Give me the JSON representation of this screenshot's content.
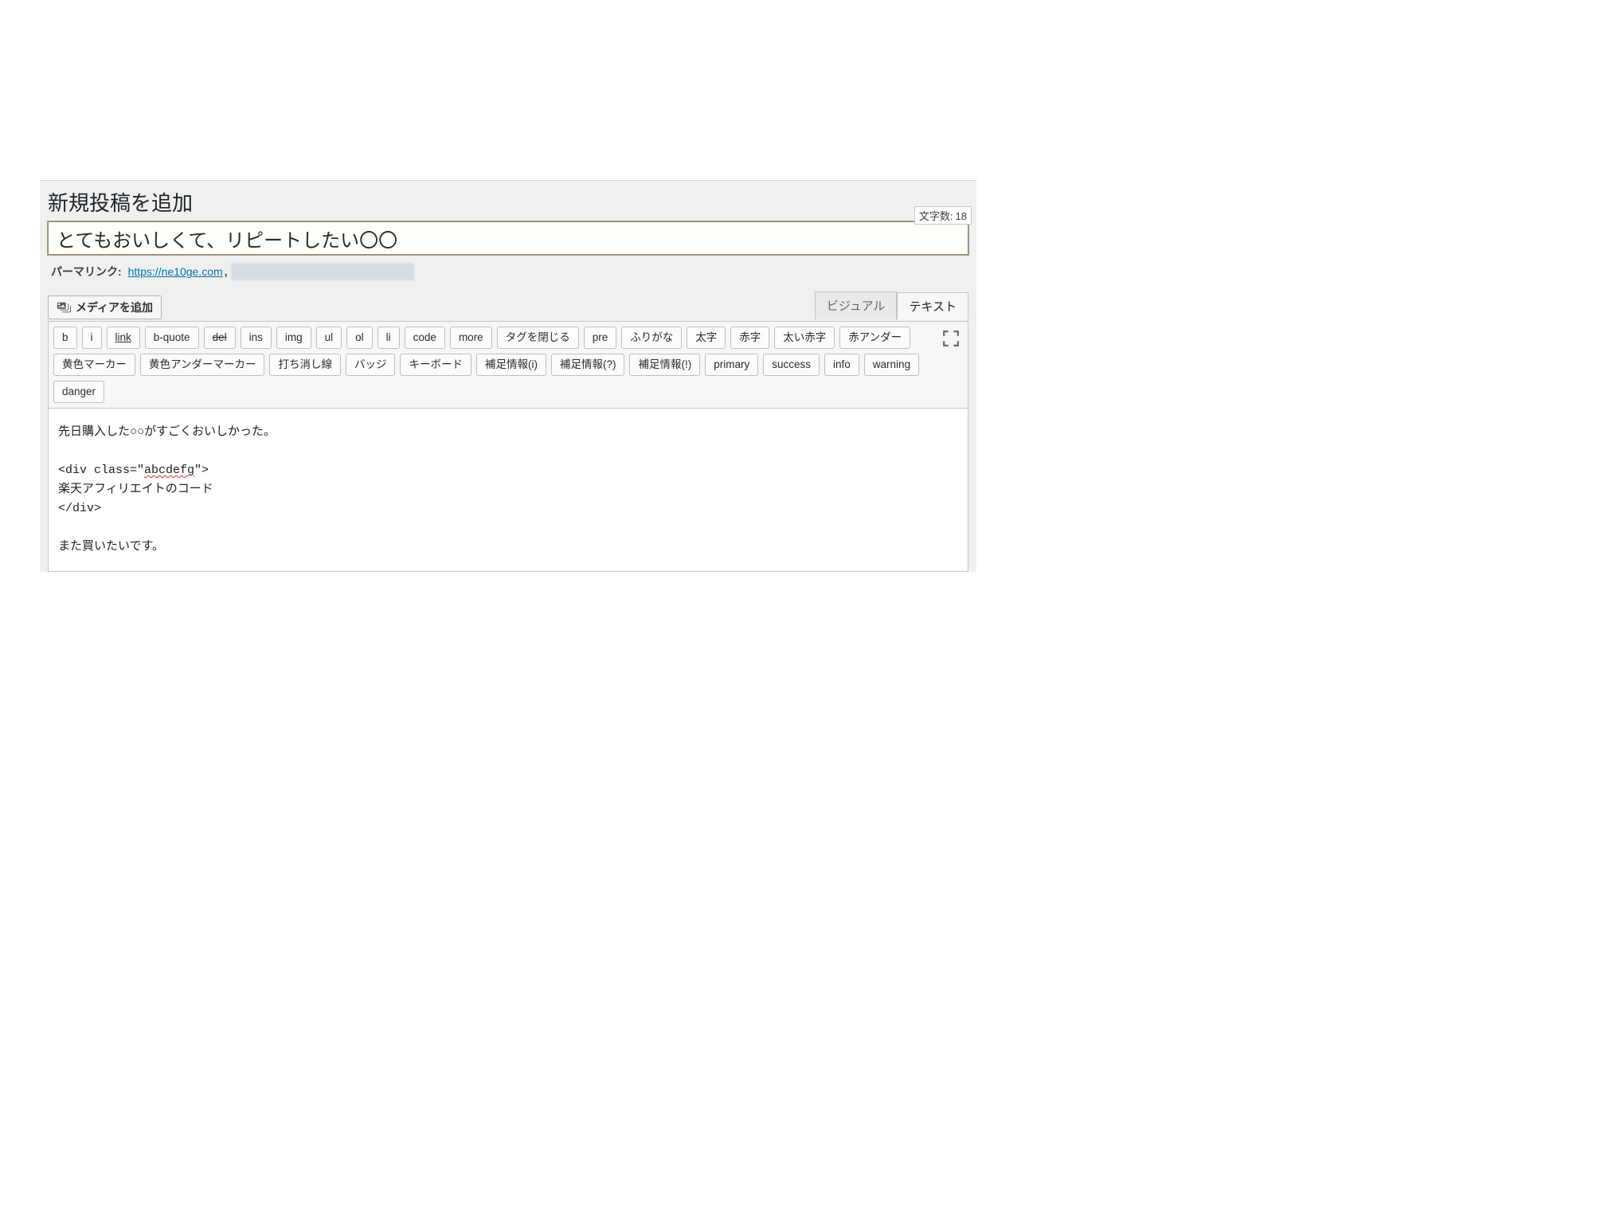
{
  "header": {
    "page_title": "新規投稿を追加",
    "char_count_label": "文字数:",
    "char_count_value": "18"
  },
  "post": {
    "title_value": "とてもおいしくて、リピートしたい〇〇"
  },
  "permalink": {
    "label": "パーマリンク:",
    "url_text": "https://ne10ge.com"
  },
  "media": {
    "add_media_label": "メディアを追加"
  },
  "tabs": {
    "visual": "ビジュアル",
    "text": "テキスト"
  },
  "toolbar": {
    "row1": {
      "b": "b",
      "i": "i",
      "link": "link",
      "bquote": "b-quote",
      "del": "del",
      "ins": "ins",
      "img": "img",
      "ul": "ul",
      "ol": "ol",
      "li": "li",
      "code": "code",
      "more": "more",
      "close_tags": "タグを閉じる",
      "pre": "pre",
      "furigana": "ふりがな",
      "bold_jp": "太字",
      "red": "赤字",
      "bold_red": "太い赤字",
      "red_under": "赤アンダー"
    },
    "row2": {
      "yellow_marker": "黄色マーカー",
      "yellow_under_marker": "黄色アンダーマーカー",
      "strike": "打ち消し線",
      "badge": "バッジ",
      "keyboard": "キーボード",
      "info_i": "補足情報(i)",
      "info_q": "補足情報(?)",
      "info_e": "補足情報(!)",
      "primary": "primary",
      "success": "success",
      "info": "info",
      "warning": "warning"
    },
    "row3": {
      "danger": "danger"
    }
  },
  "content": {
    "line1": "先日購入した○○がすごくおいしかった。",
    "blank1": "",
    "line2a": "<div class=\"",
    "line2_squiggle": "abcdefg",
    "line2b": "\">",
    "line3": "楽天アフィリエイトのコード",
    "line4": "</div>",
    "blank2": "",
    "line5": "また買いたいです。"
  }
}
